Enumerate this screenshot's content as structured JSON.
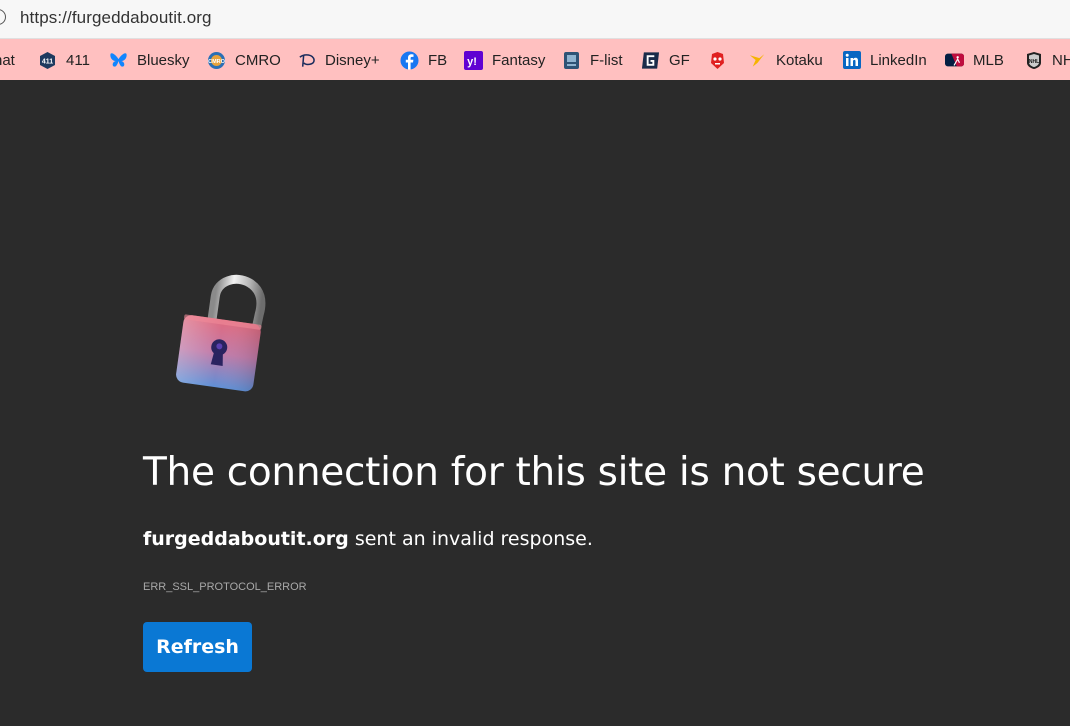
{
  "browser": {
    "url": "https://furgeddaboutit.org"
  },
  "bookmarks": [
    {
      "label": "hat",
      "icon": "chat-icon"
    },
    {
      "label": "411",
      "icon": "411-icon"
    },
    {
      "label": "Bluesky",
      "icon": "butterfly-icon"
    },
    {
      "label": "CMRO",
      "icon": "cmro-icon"
    },
    {
      "label": "Disney+",
      "icon": "disney-icon"
    },
    {
      "label": "FB",
      "icon": "facebook-icon"
    },
    {
      "label": "Fantasy",
      "icon": "yahoo-icon"
    },
    {
      "label": "F-list",
      "icon": "flist-icon"
    },
    {
      "label": "GF",
      "icon": "gf-icon"
    },
    {
      "label": "",
      "icon": "mask-icon"
    },
    {
      "label": "Kotaku",
      "icon": "kotaku-icon"
    },
    {
      "label": "LinkedIn",
      "icon": "linkedin-icon"
    },
    {
      "label": "MLB",
      "icon": "mlb-icon"
    },
    {
      "label": "NH",
      "icon": "nhl-icon"
    }
  ],
  "error": {
    "title": "The connection for this site is not secure",
    "domain": "furgeddaboutit.org",
    "message": "sent an invalid response.",
    "code": "ERR_SSL_PROTOCOL_ERROR",
    "refresh_label": "Refresh"
  },
  "colors": {
    "bookmarks_bg": "#ffc0c0",
    "page_bg": "#2b2b2b",
    "refresh_button": "#0a78d4"
  }
}
